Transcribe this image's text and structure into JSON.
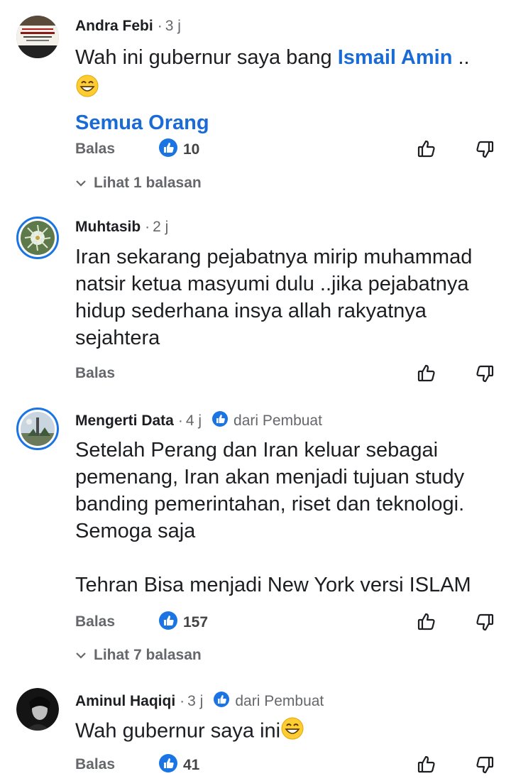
{
  "comments": [
    {
      "author": "Andra Febi",
      "time": "3 j",
      "text_before": "Wah ini gubernur saya bang ",
      "mention": "Ismail Amin",
      "text_after": " ..",
      "emoji": "grinning-face-smiling-eyes",
      "see_all": "Semua Orang",
      "reply_label": "Balas",
      "likes": "10",
      "replies_label": "Lihat 1 balasan",
      "avatar_text": "SAATNYA UMAT ISLAM DUNIA BERSATU"
    },
    {
      "author": "Muhtasib",
      "time": "2 j",
      "text": "Iran sekarang pejabatnya mirip muhammad natsir ketua masyumi dulu ..jika pejabatnya hidup sederhana insya allah rakyatnya sejahtera",
      "reply_label": "Balas"
    },
    {
      "author": "Mengerti Data",
      "time": "4 j",
      "badge": "dari Pembuat",
      "text1": "Setelah Perang dan Iran keluar sebagai pemenang, Iran akan menjadi tujuan study banding pemerintahan, riset dan teknologi. Semoga saja",
      "text2": "Tehran Bisa menjadi New York versi ISLAM",
      "reply_label": "Balas",
      "likes": "157",
      "replies_label": "Lihat 7 balasan"
    },
    {
      "author": "Aminul Haqiqi",
      "time": "3 j",
      "badge": "dari Pembuat",
      "text": "Wah gubernur saya ini",
      "emoji": "grinning-face-smiling-eyes",
      "reply_label": "Balas",
      "likes": "41"
    }
  ],
  "colors": {
    "link": "#1a6bd6",
    "like_blue": "#1b74e4",
    "secondary_text": "#65676b"
  },
  "icons": {
    "like": "like-badge-icon",
    "thumb_up": "thumb-up-icon",
    "thumb_down": "thumb-down-icon",
    "chevron": "chevron-down-icon",
    "badge": "creator-badge-icon"
  }
}
